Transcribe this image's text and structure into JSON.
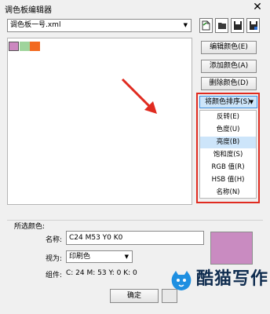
{
  "window": {
    "title": "调色板编辑器",
    "close_glyph": "✕"
  },
  "palette_select": {
    "value": "调色板一号.xml"
  },
  "toolbar": {
    "icons": [
      "new-icon",
      "open-icon",
      "save-icon",
      "save-as-icon"
    ]
  },
  "swatches": [
    {
      "color": "#cc88c0"
    },
    {
      "color": "#9fd49c"
    },
    {
      "color": "#f2691f"
    }
  ],
  "buttons": {
    "edit_color": "编辑颜色(E)",
    "add_color": "添加颜色(A)",
    "delete_color": "删除颜色(D)"
  },
  "sort": {
    "label": "将颜色排序(S)",
    "items": [
      "反转(E)",
      "色度(U)",
      "亮度(B)",
      "饱和度(S)",
      "RGB 值(R)",
      "HSB 值(H)",
      "名称(N)"
    ],
    "selected_index": 2
  },
  "selected_color": {
    "group_label": "所选颜色:",
    "name_label": "名称:",
    "name_value": "C24 M53 Y0 K0",
    "view_label": "视为:",
    "view_value": "印刷色",
    "components_label": "组件:",
    "components_value": "C: 24 M: 53 Y: 0 K: 0",
    "swatch_color": "#c98bc1"
  },
  "footer": {
    "ok_label": "确定"
  },
  "watermark": {
    "text": "酷猫写作"
  },
  "annotation_color": "#e02b20"
}
